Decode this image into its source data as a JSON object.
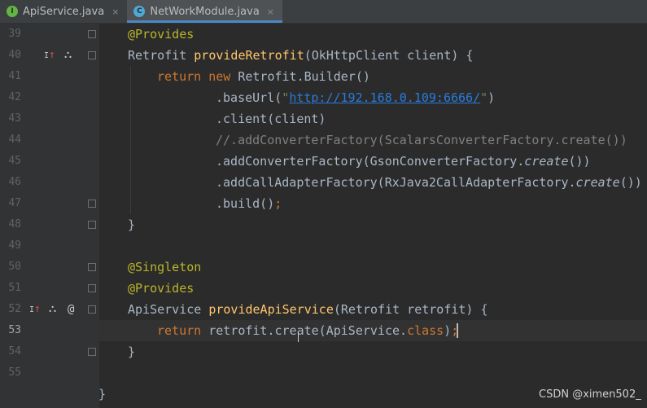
{
  "tabs": [
    {
      "label": "ApiService.java",
      "icon": "I",
      "icon_name": "interface-icon",
      "active": false
    },
    {
      "label": "NetWorkModule.java",
      "icon": "C",
      "icon_name": "class-icon",
      "active": true
    }
  ],
  "close_glyph": "×",
  "gutter_icons": {
    "override": "↑",
    "hierarchy": "⛬",
    "at": "@"
  },
  "lines": [
    {
      "n": "39",
      "text": "@Provides"
    },
    {
      "n": "40",
      "text": "Retrofit provideRetrofit(OkHttpClient client) {"
    },
    {
      "n": "41",
      "text": "return new Retrofit.Builder()"
    },
    {
      "n": "42",
      "text": ".baseUrl(\"http://192.168.0.109:6666/\")"
    },
    {
      "n": "43",
      "text": ".client(client)"
    },
    {
      "n": "44",
      "text": "//.addConverterFactory(ScalarsConverterFactory.create())"
    },
    {
      "n": "45",
      "text": ".addConverterFactory(GsonConverterFactory.create())"
    },
    {
      "n": "46",
      "text": ".addCallAdapterFactory(RxJava2CallAdapterFactory.create())"
    },
    {
      "n": "47",
      "text": ".build();"
    },
    {
      "n": "48",
      "text": "}"
    },
    {
      "n": "49",
      "text": ""
    },
    {
      "n": "50",
      "text": "@Singleton"
    },
    {
      "n": "51",
      "text": "@Provides"
    },
    {
      "n": "52",
      "text": "ApiService provideApiService(Retrofit retrofit) {"
    },
    {
      "n": "53",
      "text": "return retrofit.create(ApiService.class);"
    },
    {
      "n": "54",
      "text": "}"
    },
    {
      "n": "55",
      "text": ""
    },
    {
      "n": "",
      "text": "}"
    }
  ],
  "tokens": {
    "l39": [
      "@Provides"
    ],
    "l40": [
      "Retrofit ",
      "provideRetrofit",
      "(OkHttpClient client) {"
    ],
    "l41": [
      "return new ",
      "Retrofit.Builder()"
    ],
    "l42": [
      ".baseUrl(",
      "\"",
      "http://192.168.0.109:6666/",
      "\"",
      ")"
    ],
    "l43": [
      ".client(client)"
    ],
    "l44": [
      "//.addConverterFactory(ScalarsConverterFactory.create())"
    ],
    "l45": [
      ".addConverterFactory(GsonConverterFactory.",
      "create",
      "())"
    ],
    "l46": [
      ".addCallAdapterFactory(RxJava2CallAdapterFactory.",
      "create",
      "())"
    ],
    "l47": [
      ".build()",
      ";"
    ],
    "l48": [
      "}"
    ],
    "l50": [
      "@Singleton"
    ],
    "l51": [
      "@Provides"
    ],
    "l52": [
      "ApiService ",
      "provideApiService",
      "(Retrofit retrofit) {"
    ],
    "l53": [
      "return ",
      "retrofit.create(ApiService.",
      "class",
      ")",
      ";"
    ],
    "l54": [
      "}"
    ],
    "l56": [
      "}"
    ]
  },
  "watermark": "CSDN @ximen502_",
  "colors": {
    "background": "#2b2b2b",
    "gutter": "#313335",
    "keyword": "#cc7832",
    "annotation": "#bbb529",
    "function": "#ffc66d",
    "string": "#6a8759",
    "comment": "#808080",
    "text": "#a9b7c6",
    "tab_accent": "#4a88c7"
  }
}
